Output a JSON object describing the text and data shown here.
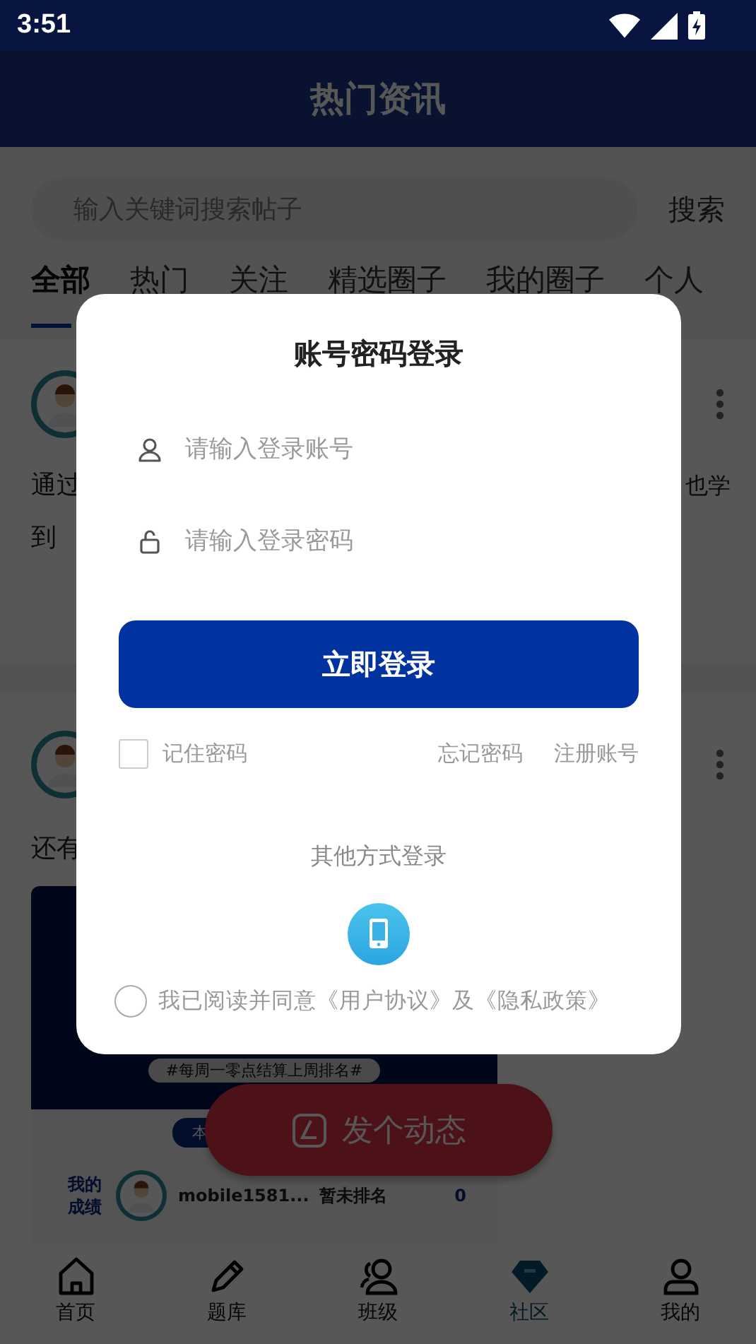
{
  "status_bar": {
    "time": "3:51"
  },
  "header": {
    "title": "热门资讯"
  },
  "search": {
    "placeholder": "输入关键词搜索帖子",
    "button": "搜索"
  },
  "tabs": [
    {
      "label": "全部",
      "selected": true
    },
    {
      "label": "热门",
      "selected": false
    },
    {
      "label": "关注",
      "selected": false
    },
    {
      "label": "精选圈子",
      "selected": false
    },
    {
      "label": "我的圈子",
      "selected": false
    },
    {
      "label": "个人",
      "selected": false
    }
  ],
  "posts": [
    {
      "text_left": [
        "通过",
        "到"
      ],
      "text_right": [
        "也学"
      ]
    },
    {
      "text_left": [
        "还有"
      ],
      "banner": {
        "tag": "#每周一零点结算上周排名#",
        "badge": "本",
        "ranking_label": "我的成绩",
        "user": "mobile1581...",
        "rank": "暂未排名",
        "score": "0"
      }
    }
  ],
  "fab": {
    "label": "发个动态"
  },
  "nav": [
    {
      "label": "首页",
      "selected": false
    },
    {
      "label": "题库",
      "selected": false
    },
    {
      "label": "班级",
      "selected": false
    },
    {
      "label": "社区",
      "selected": true
    },
    {
      "label": "我的",
      "selected": false
    }
  ],
  "dialog": {
    "title": "账号密码登录",
    "fields": [
      {
        "kind": "account",
        "placeholder": "请输入登录账号"
      },
      {
        "kind": "password",
        "placeholder": "请输入登录密码"
      }
    ],
    "submit": "立即登录",
    "remember": {
      "label": "记住密码",
      "checked": false
    },
    "links": [
      "忘记密码",
      "注册账号"
    ],
    "other_label": "其他方式登录",
    "agreement": {
      "text": "我已阅读并同意《用户协议》及《隐私政策》",
      "checked": false
    }
  }
}
